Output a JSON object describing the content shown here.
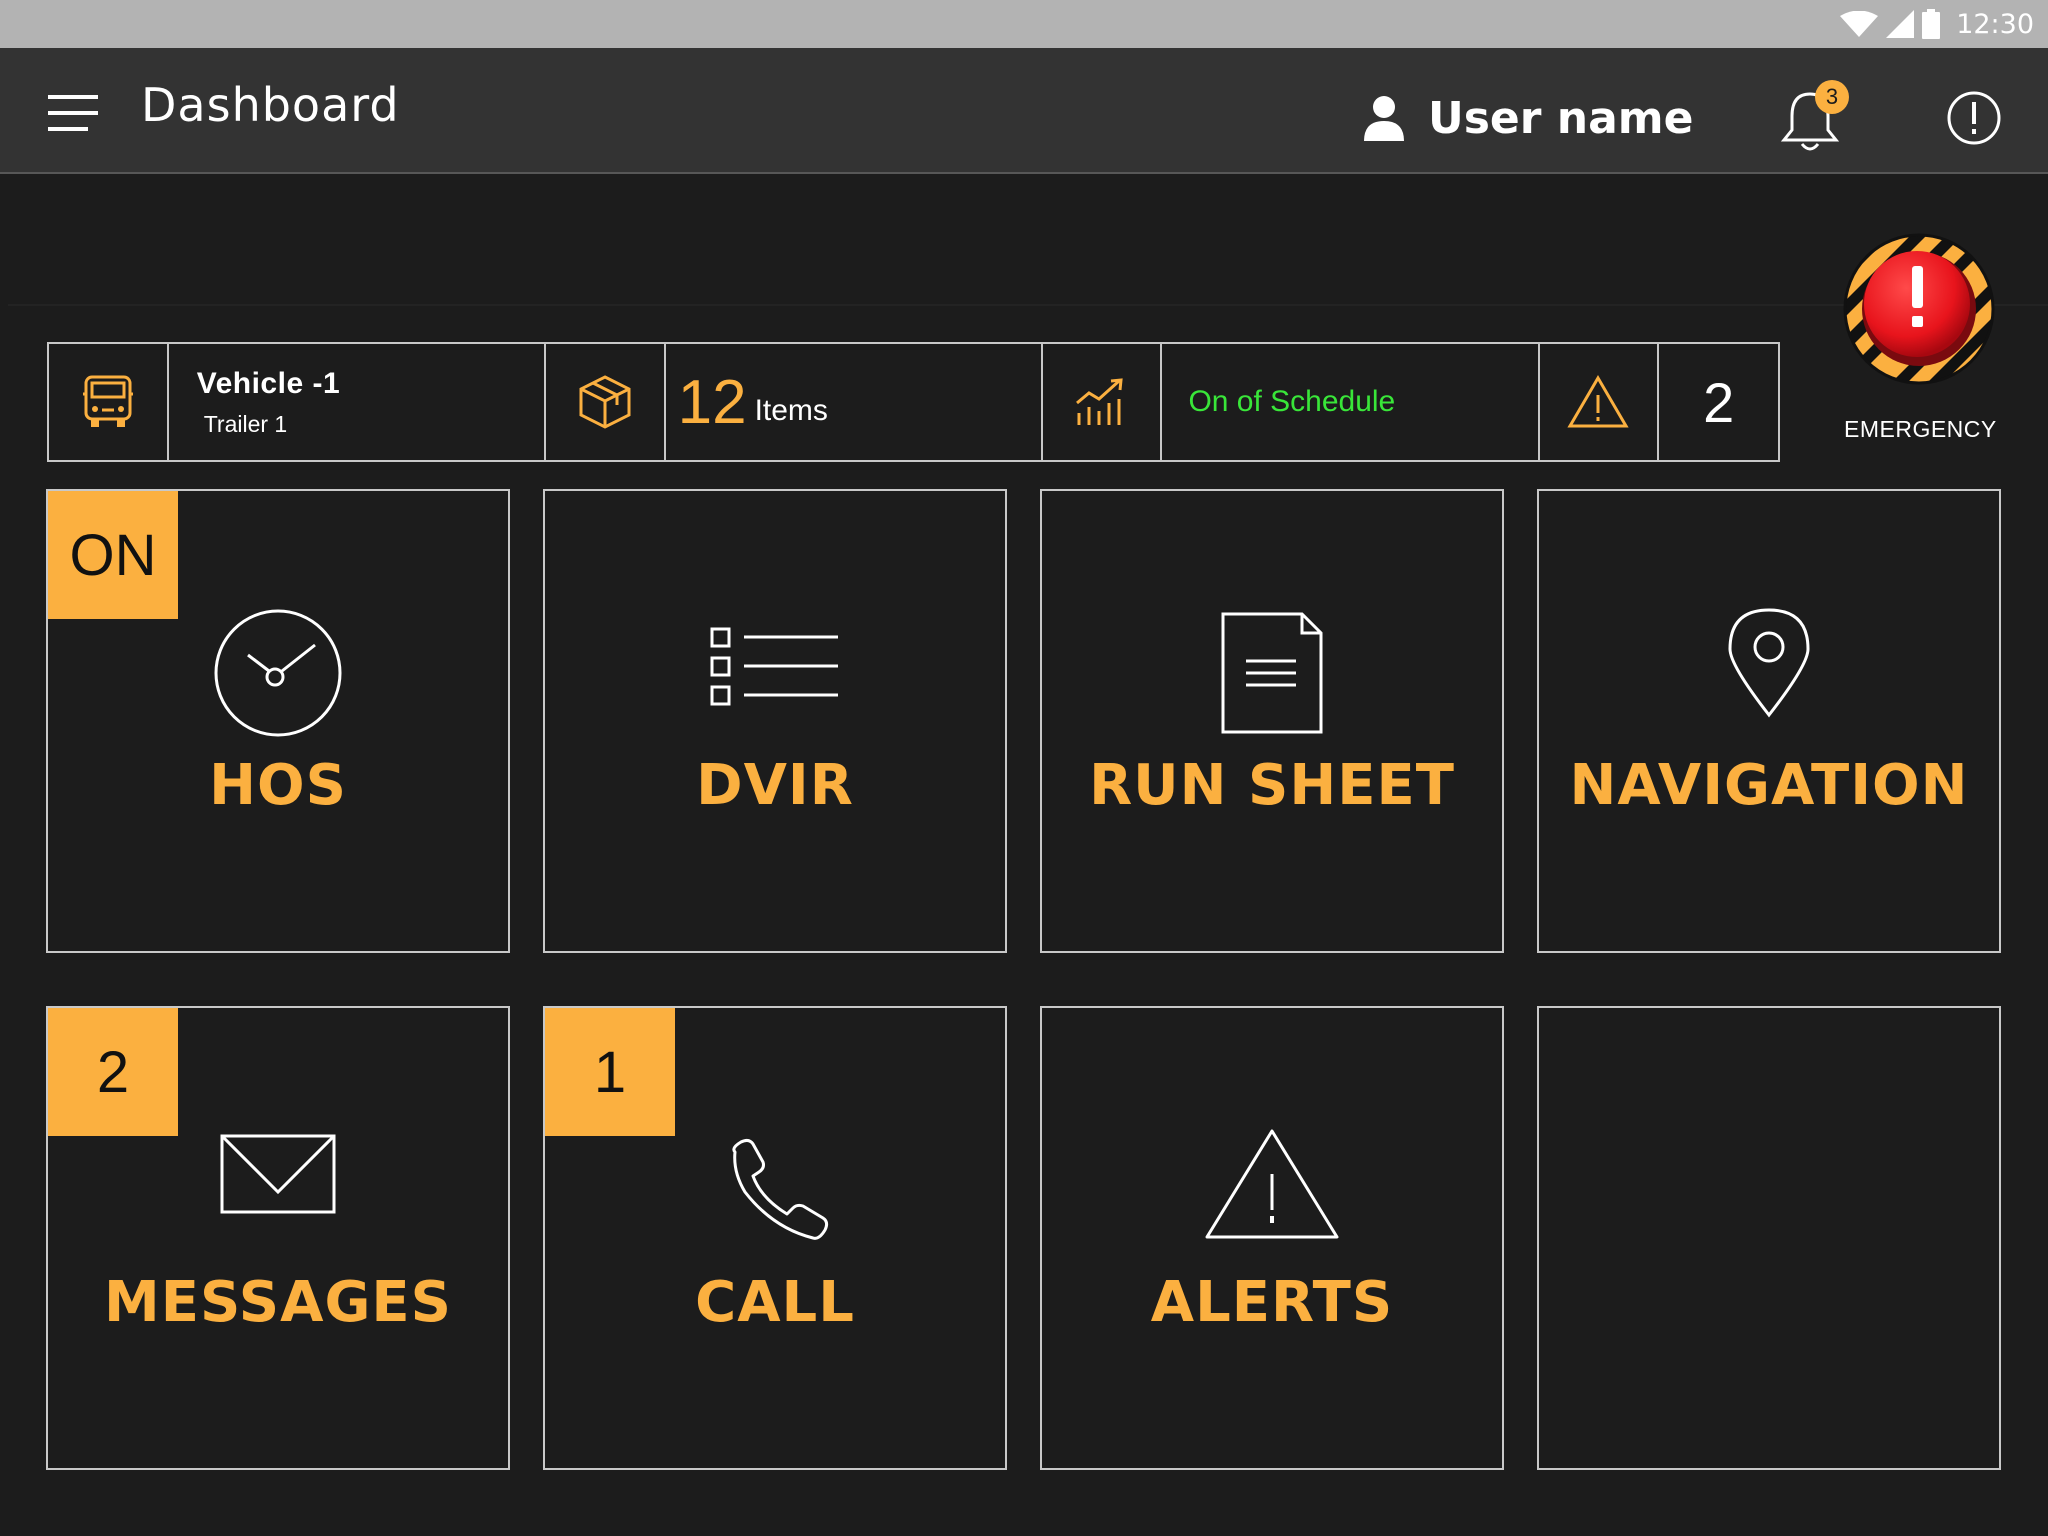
{
  "status_bar": {
    "time": "12:30"
  },
  "app_bar": {
    "title": "Dashboard",
    "user_name": "User name",
    "notification_count": "3"
  },
  "info_strip": {
    "vehicle_name": "Vehicle -1",
    "trailer": "Trailer 1",
    "items_count": "12",
    "items_label": "Items",
    "schedule_status": "On of Schedule",
    "alerts_count": "2"
  },
  "emergency": {
    "label": "EMERGENCY"
  },
  "tiles": [
    {
      "label": "HOS",
      "badge": "ON",
      "icon": "clock-icon"
    },
    {
      "label": "DVIR",
      "badge": "",
      "icon": "checklist-icon"
    },
    {
      "label": "RUN SHEET",
      "badge": "",
      "icon": "document-icon"
    },
    {
      "label": "NAVIGATION",
      "badge": "",
      "icon": "map-pin-icon"
    },
    {
      "label": "MESSAGES",
      "badge": "2",
      "icon": "envelope-icon"
    },
    {
      "label": "CALL",
      "badge": "1",
      "icon": "phone-icon"
    },
    {
      "label": "ALERTS",
      "badge": "",
      "icon": "warning-triangle-icon"
    },
    {
      "label": "",
      "badge": "",
      "icon": ""
    }
  ],
  "colors": {
    "accent": "#fbb040",
    "background": "#1c1c1c",
    "app_bar": "#333333",
    "status_bar": "#b3b3b3",
    "schedule_ok": "#39e639",
    "emergency_red": "#e8141c"
  }
}
